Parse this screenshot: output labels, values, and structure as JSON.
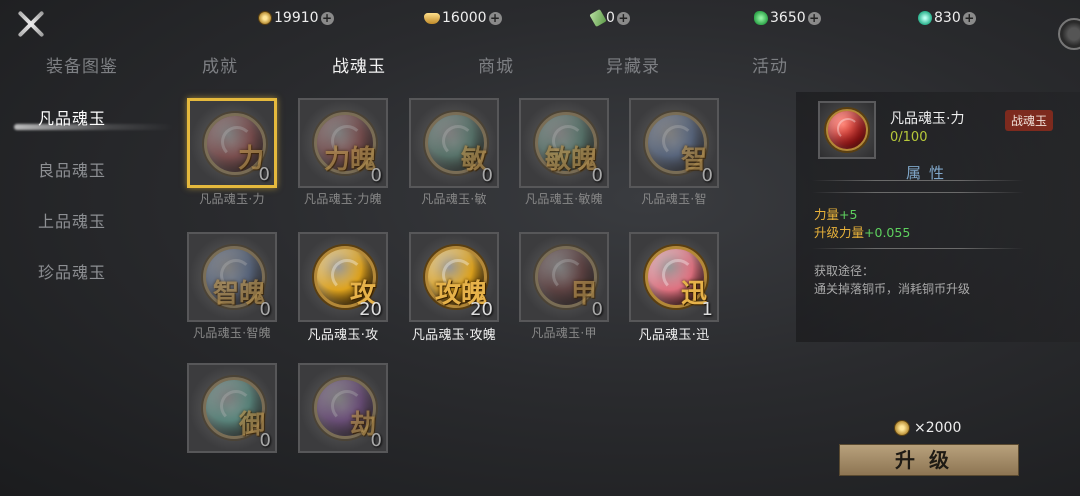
{
  "currencies": [
    {
      "icon": "copper-coin-icon",
      "value": "19910"
    },
    {
      "icon": "gold-ingot-icon",
      "value": "16000"
    },
    {
      "icon": "ticket-icon",
      "value": "0"
    },
    {
      "icon": "jade-icon",
      "value": "3650"
    },
    {
      "icon": "gem-icon",
      "value": "830"
    }
  ],
  "tabs": [
    "装备图鉴",
    "成就",
    "战魂玉",
    "商城",
    "异藏录",
    "活动"
  ],
  "active_tab": "战魂玉",
  "categories": [
    "凡品魂玉",
    "良品魂玉",
    "上品魂玉",
    "珍品魂玉"
  ],
  "items": [
    {
      "name": "凡品魂玉·力",
      "glyph": "力",
      "count": "0",
      "orb_color": "#d43a3a",
      "selected": true
    },
    {
      "name": "凡品魂玉·力魄",
      "glyph": "力魄",
      "count": "0",
      "orb_color": "#c83a3a"
    },
    {
      "name": "凡品魂玉·敏",
      "glyph": "敏",
      "count": "0",
      "orb_color": "#3a9a7a"
    },
    {
      "name": "凡品魂玉·敏魄",
      "glyph": "敏魄",
      "count": "0",
      "orb_color": "#3a9a7a"
    },
    {
      "name": "凡品魂玉·智",
      "glyph": "智",
      "count": "0",
      "orb_color": "#4a78c8"
    },
    {
      "name": "凡品魂玉·智魄",
      "glyph": "智魄",
      "count": "0",
      "orb_color": "#4a78c8"
    },
    {
      "name": "凡品魂玉·攻",
      "glyph": "攻",
      "count": "20",
      "orb_color": "#f0b020",
      "bright": true
    },
    {
      "name": "凡品魂玉·攻魄",
      "glyph": "攻魄",
      "count": "20",
      "orb_color": "#f0b020",
      "bright": true
    },
    {
      "name": "凡品魂玉·甲",
      "glyph": "甲",
      "count": "0",
      "orb_color": "#8a2a2a"
    },
    {
      "name": "凡品魂玉·迅",
      "glyph": "迅",
      "count": "1",
      "orb_color": "#f07a8a",
      "bright": true
    },
    {
      "name": "",
      "glyph": "御",
      "count": "0",
      "orb_color": "#2ac0a0"
    },
    {
      "name": "",
      "glyph": "劫",
      "count": "0",
      "orb_color": "#9a3ac8"
    }
  ],
  "detail": {
    "name": "凡品魂玉·力",
    "progress": "0/100",
    "tag": "战魂玉",
    "section_title": "属性",
    "stat1_key": "力量",
    "stat1_val": "+5",
    "stat2_key": "升级力量",
    "stat2_val": "+0.055",
    "source_title": "获取途径：",
    "source_text": "通关掉落铜币，消耗铜币升级"
  },
  "upgrade": {
    "cost": "×2000",
    "button_label": "升级"
  }
}
